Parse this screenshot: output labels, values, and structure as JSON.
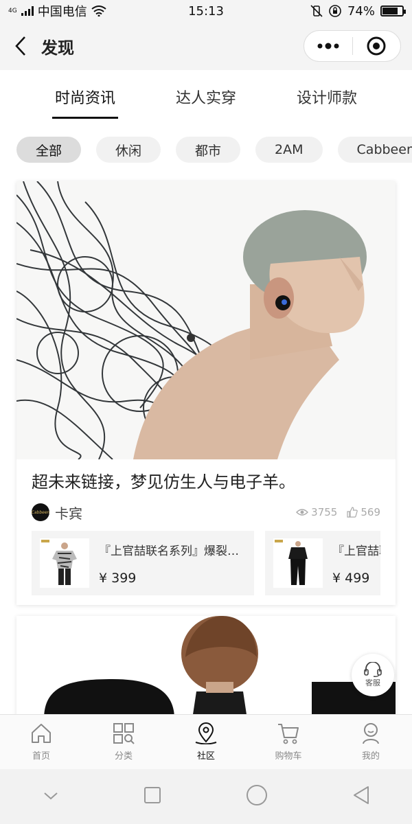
{
  "status_bar": {
    "carrier_prefix": "4G",
    "carrier": "中国电信",
    "time": "15:13",
    "battery_percent": "74%",
    "battery_level": 0.74
  },
  "header": {
    "title": "发现",
    "icons": [
      "back-icon",
      "more-icon",
      "close-target-icon"
    ]
  },
  "tabs": [
    {
      "label": "时尚资讯",
      "active": true
    },
    {
      "label": "达人实穿",
      "active": false
    },
    {
      "label": "设计师款",
      "active": false
    }
  ],
  "chips": [
    {
      "label": "全部",
      "active": true
    },
    {
      "label": "休闲",
      "active": false
    },
    {
      "label": "都市",
      "active": false
    },
    {
      "label": "2AM",
      "active": false
    },
    {
      "label": "Cabbeenlove",
      "active": false
    }
  ],
  "feed": {
    "card1": {
      "title": "超未来链接，梦见仿生人与电子羊。",
      "author": "卡宾",
      "avatar_text": "Cabbeen",
      "views": "3755",
      "likes": "569",
      "products": [
        {
          "name": "『上官喆联名系列』爆裂纹…",
          "price": "¥ 399"
        },
        {
          "name": "『上官喆联名系列』",
          "price": "¥ 499"
        }
      ]
    }
  },
  "service": {
    "label": "客服"
  },
  "tabbar": [
    {
      "label": "首页",
      "icon": "home-icon",
      "active": false
    },
    {
      "label": "分类",
      "icon": "category-icon",
      "active": false
    },
    {
      "label": "社区",
      "icon": "location-pin-icon",
      "active": true
    },
    {
      "label": "购物车",
      "icon": "cart-icon",
      "active": false
    },
    {
      "label": "我的",
      "icon": "user-icon",
      "active": false
    }
  ],
  "colors": {
    "background": "#f4f4f4",
    "text_primary": "#222222",
    "text_muted": "#888888",
    "chip_bg": "#f1f1f1",
    "chip_active_bg": "#dcdcdc"
  }
}
